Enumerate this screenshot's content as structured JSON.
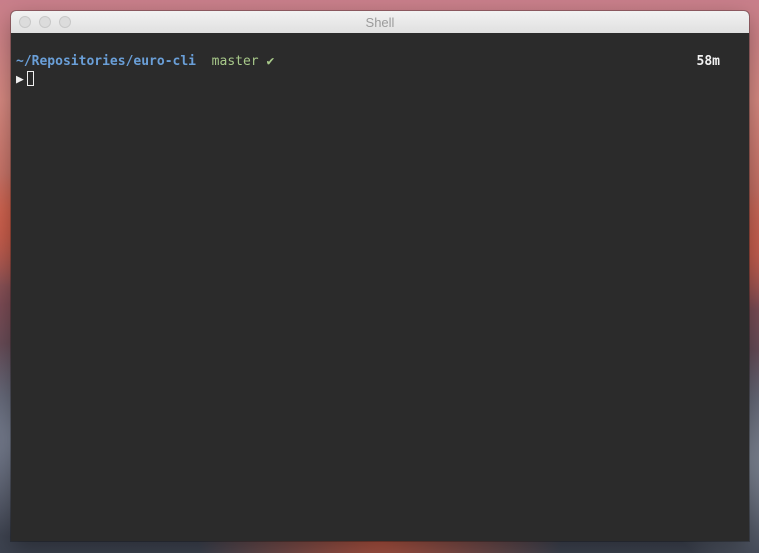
{
  "window": {
    "title": "Shell"
  },
  "terminal": {
    "cwd": "~/Repositories/euro-cli",
    "branch": "master",
    "git_status_symbol": "✔",
    "elapsed": "58m",
    "prompt_symbol": "▶"
  },
  "colors": {
    "terminal_background": "#2b2b2b",
    "cwd": "#6a9fd8",
    "branch": "#a8c98a",
    "elapsed": "#f2f2f2"
  }
}
